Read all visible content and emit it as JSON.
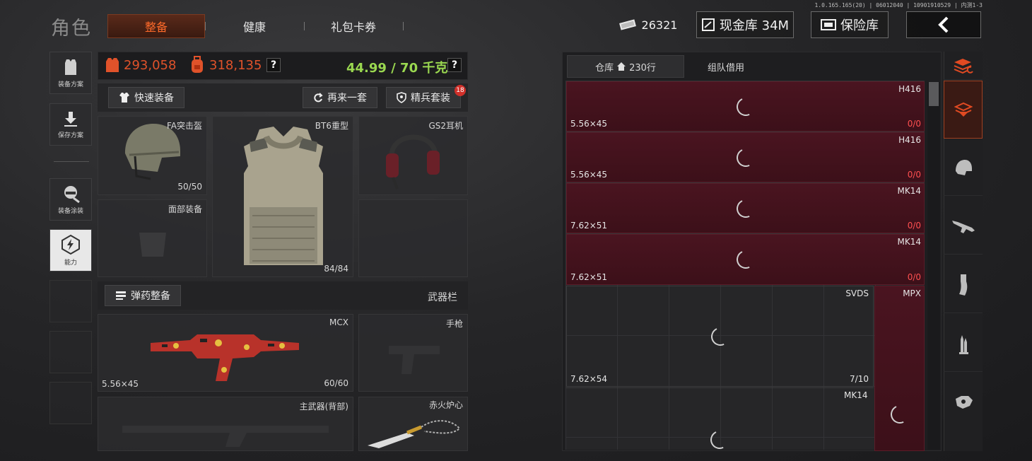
{
  "version": "1.0.165.165(20) | 06012040 | 10901910529 | 内测1-3",
  "header": {
    "title": "角色",
    "tabs": [
      {
        "label": "整备",
        "active": true
      },
      {
        "label": "健康",
        "active": false
      },
      {
        "label": "礼包卡券",
        "active": false
      }
    ],
    "money": "26321",
    "vault": "现金库 34M",
    "insurance": "保险库",
    "back_icon": "chevron-left-icon"
  },
  "sidebar": [
    {
      "label": "装备方案",
      "icon": "vest-icon"
    },
    {
      "label": "保存方案",
      "icon": "download-icon"
    },
    {
      "label": "装备涂装",
      "icon": "mask-icon"
    },
    {
      "label": "能力",
      "icon": "lightning-icon"
    }
  ],
  "stats": {
    "armor_value": "293,058",
    "bag_value": "318,135",
    "weight": "44.99 / 70 千克",
    "colors": {
      "value": "#e0522a",
      "weight": "#9ad850"
    }
  },
  "actions": {
    "quick_equip": "快速装备",
    "again": "再来一套",
    "elite": "精兵套装",
    "elite_badge": "18"
  },
  "equipment": {
    "helmet": {
      "label": "FA突击盔",
      "count": "50/50"
    },
    "armor": {
      "label": "BT6重型",
      "count": "84/84"
    },
    "headset": {
      "label": "GS2耳机"
    },
    "face": {
      "label": "面部装备"
    },
    "ammo_button": "弹药整备",
    "weapon_bar": "武器栏",
    "primary": {
      "label": "MCX",
      "caliber": "5.56×45",
      "count": "60/60"
    },
    "pistol": {
      "label": "手枪"
    },
    "back_weapon": {
      "label": "主武器(背部)"
    },
    "melee": {
      "label": "赤火炉心"
    }
  },
  "warehouse": {
    "tab_storage": "仓库",
    "storage_rows": "230行",
    "tab_team": "组队借用",
    "items": [
      {
        "name": "H416",
        "caliber": "5.56×45",
        "count": "0/0"
      },
      {
        "name": "H416",
        "caliber": "5.56×45",
        "count": "0/0"
      },
      {
        "name": "MK14",
        "caliber": "7.62×51",
        "count": "0/0"
      },
      {
        "name": "MK14",
        "caliber": "7.62×51",
        "count": "0/0"
      },
      {
        "name": "SVDS",
        "caliber": "7.62×54",
        "count": "7/10"
      },
      {
        "name": "MPX"
      },
      {
        "name": "MK14"
      }
    ],
    "accent": "#4a1420"
  },
  "right_filters": [
    "all-items-icon",
    "armor-filter-icon",
    "helmet-filter-icon",
    "rifle-icon",
    "magazine-icon",
    "ammo-icon",
    "accessory-icon"
  ]
}
